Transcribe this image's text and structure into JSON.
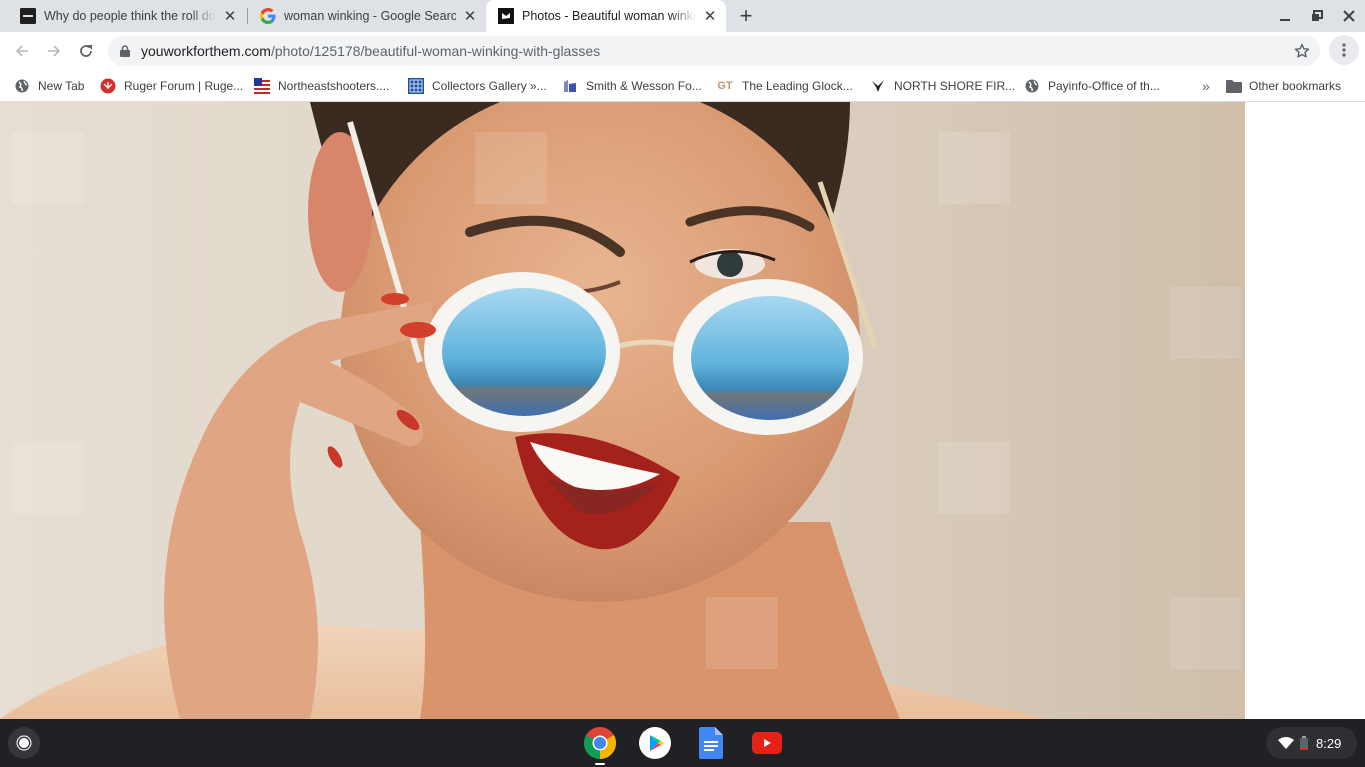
{
  "browser": {
    "tabs": [
      {
        "title": "Why do people think the roll down",
        "favicon": "site-dark-icon",
        "active": false
      },
      {
        "title": "woman winking - Google Search",
        "favicon": "google-icon",
        "active": false
      },
      {
        "title": "Photos - Beautiful woman winking with glasses",
        "favicon": "youworkforthem-icon",
        "active": true
      }
    ],
    "new_tab_label": "+",
    "address_bar": {
      "domain": "youworkforthem.com",
      "path": "/photo/125178/beautiful-woman-winking-with-glasses"
    },
    "bookmarks": [
      {
        "label": "New Tab",
        "icon": "globe-icon"
      },
      {
        "label": "Ruger Forum | Ruge...",
        "icon": "ruger-icon"
      },
      {
        "label": "Northeastshooters....",
        "icon": "flag-icon"
      },
      {
        "label": "Collectors Gallery »...",
        "icon": "grid-icon"
      },
      {
        "label": "Smith & Wesson Fo...",
        "icon": "sw-icon"
      },
      {
        "label": "The Leading Glock...",
        "icon": "gt-icon",
        "icon_text": "GT"
      },
      {
        "label": "NORTH SHORE FIR...",
        "icon": "bird-icon"
      },
      {
        "label": "Payinfo-Office of th...",
        "icon": "globe-icon"
      }
    ],
    "overflow_label": "»",
    "other_bookmarks_label": "Other bookmarks"
  },
  "page": {
    "image_description": "Woman winking while lowering round white sunglasses with blue mirrored lenses, red lipstick"
  },
  "shelf": {
    "apps": [
      {
        "name": "Chrome",
        "icon": "chrome-icon",
        "running": true
      },
      {
        "name": "Play Store",
        "icon": "play-store-icon",
        "running": false
      },
      {
        "name": "Docs",
        "icon": "docs-icon",
        "running": false
      },
      {
        "name": "YouTube",
        "icon": "youtube-icon",
        "running": false
      }
    ],
    "time": "8:29"
  },
  "colors": {
    "tabstrip_bg": "#dee1e6",
    "shelf_bg": "#202124",
    "photo_bg": "#e3d8cc",
    "lens_blue": "#5fb3dc",
    "lip_red": "#b3201c"
  }
}
